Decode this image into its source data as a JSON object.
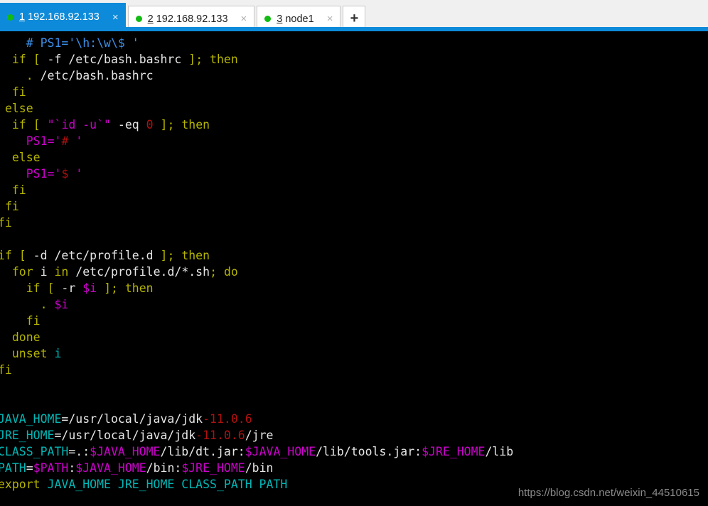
{
  "window": {
    "kind": "ssh-terminal",
    "background": "#000000",
    "accent": "#0d8bda"
  },
  "tabbar": {
    "new_tab_label": "+",
    "close_glyph": "×",
    "status_dot_color": "#12bb12",
    "tabs": [
      {
        "index": "1",
        "title": "192.168.92.133",
        "active": true
      },
      {
        "index": "2",
        "title": "192.168.92.133",
        "active": false
      },
      {
        "index": "3",
        "title": "node1",
        "active": false
      }
    ]
  },
  "terminal": {
    "palette": {
      "default": "#e6e6e6",
      "yellow": "#b5b500",
      "blue": "#3b8fe8",
      "magenta": "#cc00cc",
      "red": "#b01010",
      "cyan": "#00b6b6"
    },
    "lines": [
      [
        {
          "t": "    ",
          "c": "def"
        },
        {
          "t": "# PS1='\\h:\\w\\$ '",
          "c": "blu"
        }
      ],
      [
        {
          "t": "  ",
          "c": "def"
        },
        {
          "t": "if",
          "c": "yel"
        },
        {
          "t": " ",
          "c": "def"
        },
        {
          "t": "[",
          "c": "yel"
        },
        {
          "t": " -f /etc/bash.bashrc ",
          "c": "def"
        },
        {
          "t": "]",
          "c": "yel"
        },
        {
          "t": ";",
          "c": "yel"
        },
        {
          "t": " ",
          "c": "def"
        },
        {
          "t": "then",
          "c": "yel"
        }
      ],
      [
        {
          "t": "    ",
          "c": "def"
        },
        {
          "t": ".",
          "c": "yel"
        },
        {
          "t": " /etc/bash.bashrc",
          "c": "def"
        }
      ],
      [
        {
          "t": "  ",
          "c": "def"
        },
        {
          "t": "fi",
          "c": "yel"
        }
      ],
      [
        {
          "t": " ",
          "c": "def"
        },
        {
          "t": "else",
          "c": "yel"
        }
      ],
      [
        {
          "t": "  ",
          "c": "def"
        },
        {
          "t": "if",
          "c": "yel"
        },
        {
          "t": " ",
          "c": "def"
        },
        {
          "t": "[",
          "c": "yel"
        },
        {
          "t": " ",
          "c": "def"
        },
        {
          "t": "\"`",
          "c": "mag"
        },
        {
          "t": "id -u",
          "c": "mag"
        },
        {
          "t": "`\"",
          "c": "mag"
        },
        {
          "t": " -eq ",
          "c": "def"
        },
        {
          "t": "0",
          "c": "red"
        },
        {
          "t": " ",
          "c": "def"
        },
        {
          "t": "]",
          "c": "yel"
        },
        {
          "t": ";",
          "c": "yel"
        },
        {
          "t": " ",
          "c": "def"
        },
        {
          "t": "then",
          "c": "yel"
        }
      ],
      [
        {
          "t": "    ",
          "c": "def"
        },
        {
          "t": "PS1=",
          "c": "mag"
        },
        {
          "t": "'",
          "c": "mag"
        },
        {
          "t": "#",
          "c": "red"
        },
        {
          "t": " ",
          "c": "def"
        },
        {
          "t": "'",
          "c": "mag"
        }
      ],
      [
        {
          "t": "  ",
          "c": "def"
        },
        {
          "t": "else",
          "c": "yel"
        }
      ],
      [
        {
          "t": "    ",
          "c": "def"
        },
        {
          "t": "PS1=",
          "c": "mag"
        },
        {
          "t": "'",
          "c": "mag"
        },
        {
          "t": "$",
          "c": "red"
        },
        {
          "t": " ",
          "c": "def"
        },
        {
          "t": "'",
          "c": "mag"
        }
      ],
      [
        {
          "t": "  ",
          "c": "def"
        },
        {
          "t": "fi",
          "c": "yel"
        }
      ],
      [
        {
          "t": " ",
          "c": "def"
        },
        {
          "t": "fi",
          "c": "yel"
        }
      ],
      [
        {
          "t": "fi",
          "c": "yel"
        }
      ],
      [
        {
          "t": "",
          "c": "def"
        }
      ],
      [
        {
          "t": "if",
          "c": "yel"
        },
        {
          "t": " ",
          "c": "def"
        },
        {
          "t": "[",
          "c": "yel"
        },
        {
          "t": " -d /etc/profile.d ",
          "c": "def"
        },
        {
          "t": "]",
          "c": "yel"
        },
        {
          "t": ";",
          "c": "yel"
        },
        {
          "t": " ",
          "c": "def"
        },
        {
          "t": "then",
          "c": "yel"
        }
      ],
      [
        {
          "t": "  ",
          "c": "def"
        },
        {
          "t": "for",
          "c": "yel"
        },
        {
          "t": " i ",
          "c": "def"
        },
        {
          "t": "in",
          "c": "yel"
        },
        {
          "t": " /etc/profile.d/*.sh",
          "c": "def"
        },
        {
          "t": ";",
          "c": "yel"
        },
        {
          "t": " ",
          "c": "def"
        },
        {
          "t": "do",
          "c": "yel"
        }
      ],
      [
        {
          "t": "    ",
          "c": "def"
        },
        {
          "t": "if",
          "c": "yel"
        },
        {
          "t": " ",
          "c": "def"
        },
        {
          "t": "[",
          "c": "yel"
        },
        {
          "t": " -r ",
          "c": "def"
        },
        {
          "t": "$i",
          "c": "mag"
        },
        {
          "t": " ",
          "c": "def"
        },
        {
          "t": "]",
          "c": "yel"
        },
        {
          "t": ";",
          "c": "yel"
        },
        {
          "t": " ",
          "c": "def"
        },
        {
          "t": "then",
          "c": "yel"
        }
      ],
      [
        {
          "t": "      ",
          "c": "def"
        },
        {
          "t": ".",
          "c": "yel"
        },
        {
          "t": " ",
          "c": "def"
        },
        {
          "t": "$i",
          "c": "mag"
        }
      ],
      [
        {
          "t": "    ",
          "c": "def"
        },
        {
          "t": "fi",
          "c": "yel"
        }
      ],
      [
        {
          "t": "  ",
          "c": "def"
        },
        {
          "t": "done",
          "c": "yel"
        }
      ],
      [
        {
          "t": "  ",
          "c": "def"
        },
        {
          "t": "unset",
          "c": "yel"
        },
        {
          "t": " ",
          "c": "def"
        },
        {
          "t": "i",
          "c": "cya"
        }
      ],
      [
        {
          "t": "fi",
          "c": "yel"
        }
      ],
      [
        {
          "t": "",
          "c": "def"
        }
      ],
      [
        {
          "t": "",
          "c": "def"
        }
      ],
      [
        {
          "t": "JAVA_HOME",
          "c": "cya"
        },
        {
          "t": "=/usr/local/java/jdk",
          "c": "def"
        },
        {
          "t": "-11.0.6",
          "c": "red"
        }
      ],
      [
        {
          "t": "JRE_HOME",
          "c": "cya"
        },
        {
          "t": "=/usr/local/java/jdk",
          "c": "def"
        },
        {
          "t": "-11.0.6",
          "c": "red"
        },
        {
          "t": "/jre",
          "c": "def"
        }
      ],
      [
        {
          "t": "CLASS_PATH",
          "c": "cya"
        },
        {
          "t": "=.:",
          "c": "def"
        },
        {
          "t": "$JAVA_HOME",
          "c": "mag"
        },
        {
          "t": "/lib/dt.jar:",
          "c": "def"
        },
        {
          "t": "$JAVA_HOME",
          "c": "mag"
        },
        {
          "t": "/lib/tools.jar:",
          "c": "def"
        },
        {
          "t": "$JRE_HOME",
          "c": "mag"
        },
        {
          "t": "/lib",
          "c": "def"
        }
      ],
      [
        {
          "t": "PATH",
          "c": "cya"
        },
        {
          "t": "=",
          "c": "def"
        },
        {
          "t": "$PATH",
          "c": "mag"
        },
        {
          "t": ":",
          "c": "def"
        },
        {
          "t": "$JAVA_HOME",
          "c": "mag"
        },
        {
          "t": "/bin:",
          "c": "def"
        },
        {
          "t": "$JRE_HOME",
          "c": "mag"
        },
        {
          "t": "/bin",
          "c": "def"
        }
      ],
      [
        {
          "t": "export",
          "c": "yel"
        },
        {
          "t": " ",
          "c": "def"
        },
        {
          "t": "JAVA_HOME JRE_HOME CLASS_PATH PATH",
          "c": "cya"
        }
      ]
    ]
  },
  "watermark": {
    "text": "https://blog.csdn.net/weixin_44510615"
  }
}
